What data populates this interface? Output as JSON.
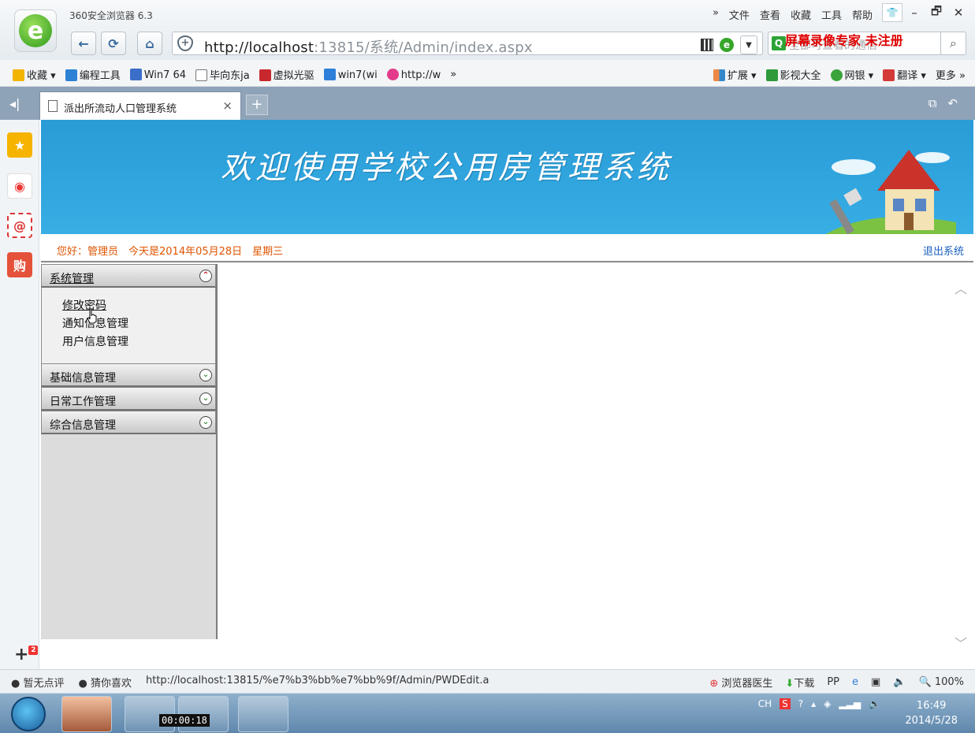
{
  "browser": {
    "app_title": "360安全浏览器 6.3",
    "menu": [
      "文件",
      "查看",
      "收藏",
      "工具",
      "帮助"
    ],
    "menu_prefix": "»",
    "url_host": "http://localhost",
    "url_rest": ":13815/系统/Admin/index.aspx",
    "search_text": "全部可查看的通信",
    "recorder_watermark": "屏幕录像专家 未注册"
  },
  "favorites": {
    "left": [
      "收藏",
      "编程工具",
      "Win7 64",
      "毕向东ja",
      "虚拟光驱",
      "win7(wi",
      "http://w"
    ],
    "more_left": "»",
    "right": [
      "扩展",
      "影视大全",
      "网银",
      "翻译",
      "更多"
    ]
  },
  "tab": {
    "label": "派出所流动人口管理系统",
    "close": "×",
    "new": "+"
  },
  "page": {
    "banner_title": "欢迎使用学校公用房管理系统",
    "greeting": "您好：管理员　今天是2014年05月28日　星期三",
    "logout": "退出系统",
    "menu": {
      "groups": [
        {
          "label": "系统管理",
          "expanded": true,
          "items": [
            "修改密码",
            "通知信息管理",
            "用户信息管理"
          ]
        },
        {
          "label": "基础信息管理",
          "expanded": false
        },
        {
          "label": "日常工作管理",
          "expanded": false
        },
        {
          "label": "综合信息管理",
          "expanded": false
        }
      ]
    }
  },
  "status": {
    "rating": "暂无点评",
    "guess": "猜你喜欢",
    "link": "http://localhost:13815/%e7%b3%bb%e7%bb%9f/Admin/PWDEdit.a",
    "doctor": "浏览器医生",
    "download": "下载",
    "zoom": "100%"
  },
  "taskbar": {
    "rec_time": "00:00:18",
    "lang": "CH",
    "time": "16:49",
    "date": "2014/5/28"
  },
  "sidebar_badge": "2"
}
